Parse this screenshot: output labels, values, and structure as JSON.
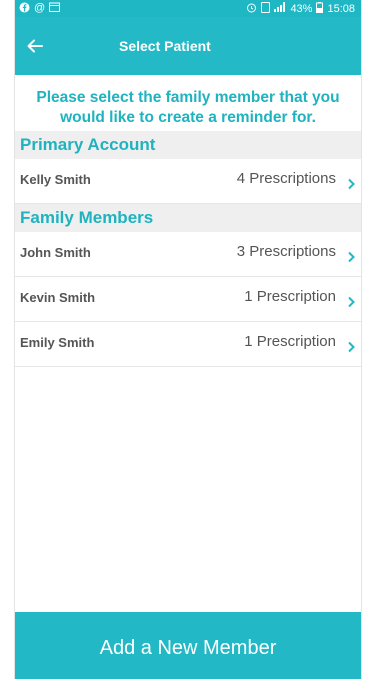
{
  "status_bar": {
    "battery": "43%",
    "time": "15:08"
  },
  "header": {
    "title": "Select Patient"
  },
  "instruction": "Please select the family member that you would like to create a reminder for.",
  "sections": [
    {
      "title": "Primary Account",
      "members": [
        {
          "name": "Kelly Smith",
          "count": "4 Prescriptions"
        }
      ]
    },
    {
      "title": "Family Members",
      "members": [
        {
          "name": "John Smith",
          "count": "3 Prescriptions"
        },
        {
          "name": "Kevin Smith",
          "count": "1 Prescription"
        },
        {
          "name": "Emily Smith",
          "count": "1 Prescription"
        }
      ]
    }
  ],
  "footer": {
    "add_button_label": "Add a New Member"
  },
  "colors": {
    "accent": "#22b8c5",
    "section_bg": "#efefef",
    "text": "#555555"
  }
}
